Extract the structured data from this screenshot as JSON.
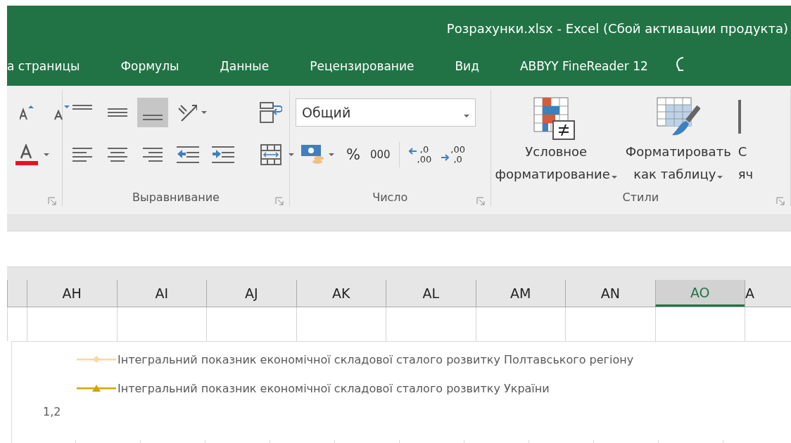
{
  "window": {
    "title": "Розрахунки.xlsx - Excel (Сбой активации продукта)"
  },
  "tabs": [
    {
      "label": "а страницы",
      "selected": false
    },
    {
      "label": "Формулы",
      "selected": false
    },
    {
      "label": "Данные",
      "selected": false
    },
    {
      "label": "Рецензирование",
      "selected": false
    },
    {
      "label": "Вид",
      "selected": false
    },
    {
      "label": "ABBYY FineReader 12",
      "selected": false
    }
  ],
  "ribbon": {
    "alignment_group": {
      "label": "Выравнивание",
      "buttons": [
        {
          "kind": "align-top",
          "selected": false
        },
        {
          "kind": "align-middle",
          "selected": false
        },
        {
          "kind": "align-bottom",
          "selected": true
        },
        {
          "kind": "orientation",
          "selected": false
        },
        {
          "kind": "align-left",
          "selected": false
        },
        {
          "kind": "align-center",
          "selected": false
        },
        {
          "kind": "align-right",
          "selected": false
        },
        {
          "kind": "outdent",
          "selected": false
        },
        {
          "kind": "indent",
          "selected": false
        }
      ]
    },
    "number_group": {
      "label": "Число",
      "format": {
        "value": "Общий"
      },
      "percent": "%",
      "thousands": "000",
      "decimals": [
        {
          "kind": "increase",
          "top": ",0",
          "bottom": ",00"
        },
        {
          "kind": "decrease",
          "top": ",00",
          "bottom": ",0"
        }
      ]
    },
    "styles_group": {
      "label": "Стили",
      "buttons": [
        {
          "kind": "conditional",
          "lines": [
            "Условное",
            "форматирование"
          ],
          "dropdown": true
        },
        {
          "kind": "table",
          "lines": [
            "Форматировать",
            "как таблицу"
          ],
          "dropdown": true
        },
        {
          "kind": "cell",
          "lines": [
            "С",
            "яч"
          ],
          "dropdown": false
        }
      ]
    }
  },
  "columns": [
    {
      "label": "AH",
      "selected": false
    },
    {
      "label": "AI",
      "selected": false
    },
    {
      "label": "AJ",
      "selected": false
    },
    {
      "label": "AK",
      "selected": false
    },
    {
      "label": "AL",
      "selected": false
    },
    {
      "label": "AM",
      "selected": false
    },
    {
      "label": "AN",
      "selected": false
    },
    {
      "label": "AO",
      "selected": true
    },
    {
      "label": "A",
      "selected": false
    }
  ],
  "chart": {
    "legend": [
      {
        "label": "Інтегральний показник економічної складової сталого розвитку Полтавського регіону",
        "color": "#fdd7a0",
        "kind": "diamond"
      },
      {
        "label": "Інтегральний показник економічної складової сталого розвитку України",
        "color": "#d4a20a",
        "kind": "triangle"
      }
    ],
    "y_tick": "1,2"
  }
}
